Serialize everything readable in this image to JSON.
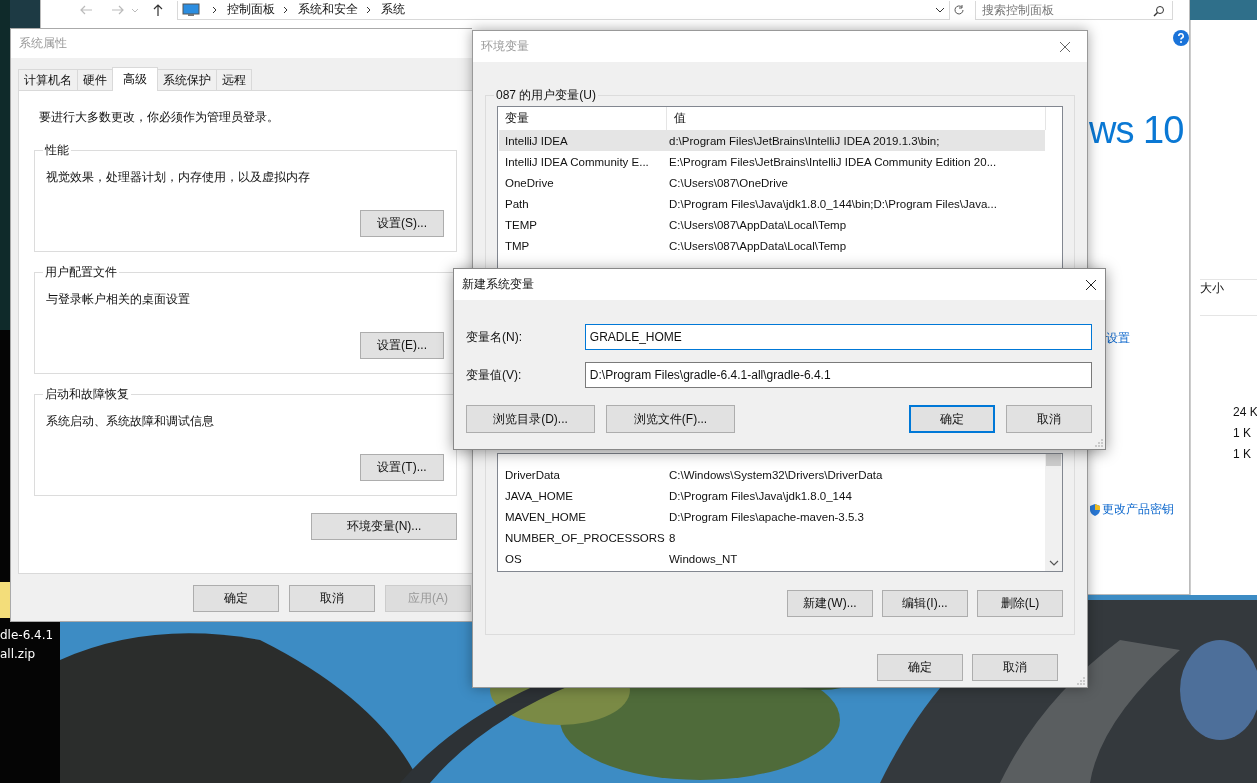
{
  "desktop": {
    "file_label": [
      "dle-6.4.1",
      "all.zip"
    ]
  },
  "explorer": {
    "breadcrumb": [
      "控制面板",
      "系统和安全",
      "系统"
    ],
    "search": {
      "placeholder": "搜索控制面板"
    },
    "logo_text": "ws 10",
    "settings_link": "设置",
    "product_key_link": "更改产品密钥"
  },
  "file_window": {
    "column": "大小",
    "sizes": [
      "24 K",
      "1 K",
      "1 K"
    ]
  },
  "system_properties": {
    "title": "系统属性",
    "tabs": [
      {
        "label": "计算机名",
        "selected": false
      },
      {
        "label": "硬件",
        "selected": false
      },
      {
        "label": "高级",
        "selected": true
      },
      {
        "label": "系统保护",
        "selected": false
      },
      {
        "label": "远程",
        "selected": false
      }
    ],
    "notice": "要进行大多数更改，你必须作为管理员登录。",
    "groups": [
      {
        "title": "性能",
        "description": "视觉效果，处理器计划，内存使用，以及虚拟内存",
        "button": "设置(S)..."
      },
      {
        "title": "用户配置文件",
        "description": "与登录帐户相关的桌面设置",
        "button": "设置(E)..."
      },
      {
        "title": "启动和故障恢复",
        "description": "系统启动、系统故障和调试信息",
        "button": "设置(T)..."
      }
    ],
    "env_button": "环境变量(N)...",
    "buttons": [
      {
        "label": "确定",
        "disabled": false
      },
      {
        "label": "取消",
        "disabled": false
      },
      {
        "label": "应用(A)",
        "disabled": true
      }
    ]
  },
  "environment_variables": {
    "title": "环境变量",
    "user_group": "087 的用户变量(U)",
    "columns": [
      "变量",
      "值"
    ],
    "user_rows": [
      {
        "name": "IntelliJ IDEA",
        "value": "d:\\Program Files\\JetBrains\\IntelliJ IDEA 2019.1.3\\bin;",
        "selected": true
      },
      {
        "name": "IntelliJ IDEA Community E...",
        "value": "E:\\Program Files\\JetBrains\\IntelliJ IDEA Community Edition 20...",
        "selected": false
      },
      {
        "name": "OneDrive",
        "value": "C:\\Users\\087\\OneDrive",
        "selected": false
      },
      {
        "name": "Path",
        "value": "D:\\Program Files\\Java\\jdk1.8.0_144\\bin;D:\\Program Files\\Java...",
        "selected": false
      },
      {
        "name": "TEMP",
        "value": "C:\\Users\\087\\AppData\\Local\\Temp",
        "selected": false
      },
      {
        "name": "TMP",
        "value": "C:\\Users\\087\\AppData\\Local\\Temp",
        "selected": false
      }
    ],
    "system_rows": [
      {
        "name": "DriverData",
        "value": "C:\\Windows\\System32\\Drivers\\DriverData",
        "selected": false
      },
      {
        "name": "JAVA_HOME",
        "value": "D:\\Program Files\\Java\\jdk1.8.0_144",
        "selected": false
      },
      {
        "name": "MAVEN_HOME",
        "value": "D:\\Program Files\\apache-maven-3.5.3",
        "selected": false
      },
      {
        "name": "NUMBER_OF_PROCESSORS",
        "value": "8",
        "selected": false
      },
      {
        "name": "OS",
        "value": "Windows_NT",
        "selected": false
      }
    ],
    "list_buttons": [
      "新建(W)...",
      "编辑(I)...",
      "删除(L)"
    ],
    "buttons": [
      "确定",
      "取消"
    ]
  },
  "new_variable_dialog": {
    "title": "新建系统变量",
    "fields": [
      {
        "label": "变量名(N):",
        "value": "GRADLE_HOME",
        "focused": true
      },
      {
        "label": "变量值(V):",
        "value": "D:\\Program Files\\gradle-6.4.1-all\\gradle-6.4.1",
        "focused": false
      }
    ],
    "browse_buttons": [
      "浏览目录(D)...",
      "浏览文件(F)..."
    ],
    "ok": {
      "label": "确定",
      "default": true
    },
    "cancel": "取消"
  }
}
